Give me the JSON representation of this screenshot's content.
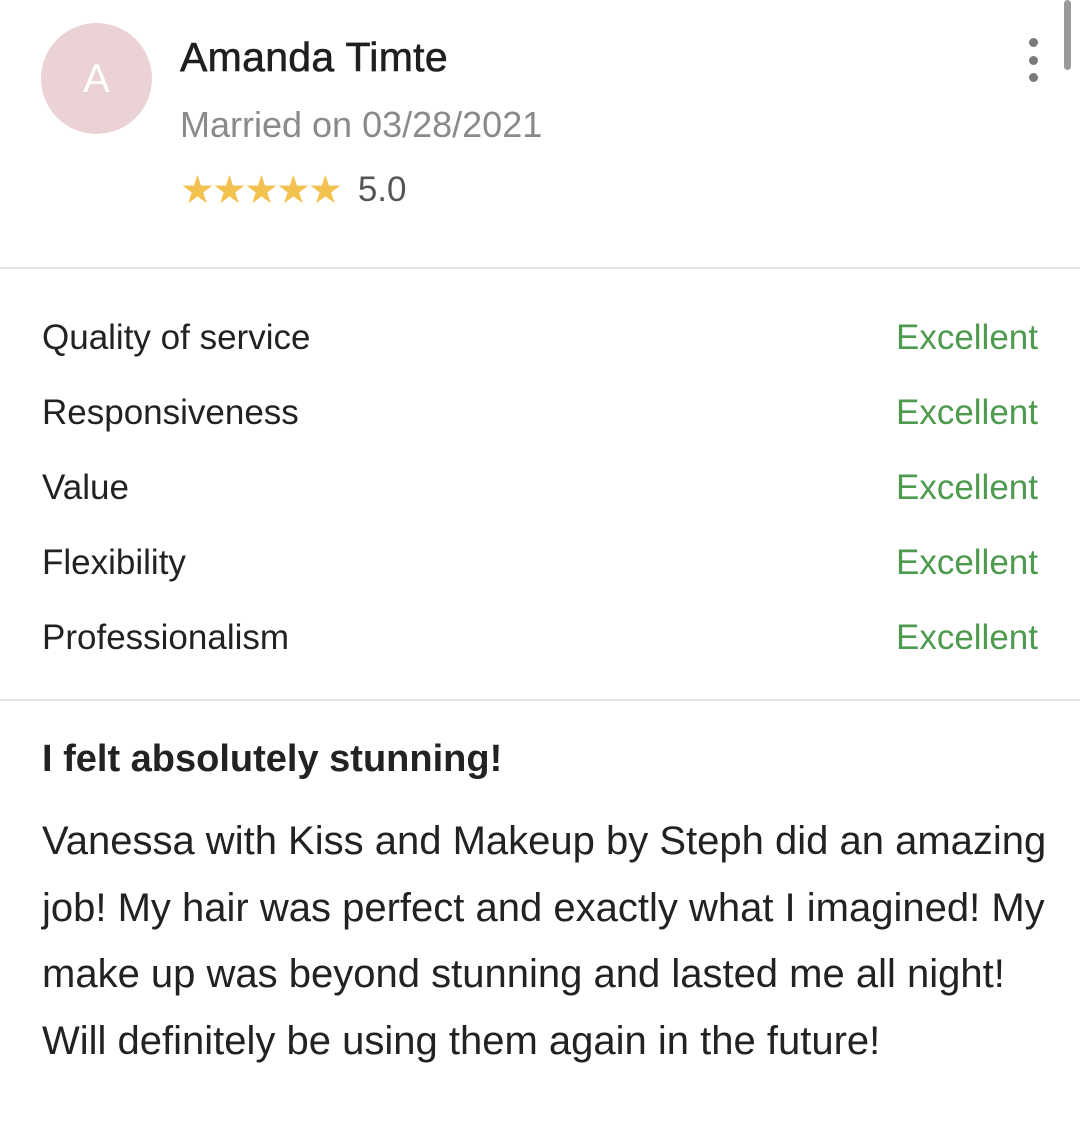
{
  "reviewer": {
    "avatar_letter": "A",
    "name": "Amanda Timte",
    "married": "Married on 03/28/2021",
    "rating": "5.0",
    "stars": 5
  },
  "ratings": [
    {
      "label": "Quality of service",
      "value": "Excellent"
    },
    {
      "label": "Responsiveness",
      "value": "Excellent"
    },
    {
      "label": "Value",
      "value": "Excellent"
    },
    {
      "label": "Flexibility",
      "value": "Excellent"
    },
    {
      "label": "Professionalism",
      "value": "Excellent"
    }
  ],
  "review": {
    "title": "I felt absolutely stunning!",
    "body": "Vanessa with Kiss and Makeup by Steph did an amazing job! My hair was perfect and exactly what I imagined! My make up was beyond stunning and lasted me all night! Will definitely be using them again in the future!"
  },
  "colors": {
    "star": "#f2c14e",
    "verdict": "#4e9a4f",
    "avatar_bg": "#ebd2d4"
  },
  "icons": {
    "star": "star-icon",
    "more": "more-vertical-icon"
  }
}
